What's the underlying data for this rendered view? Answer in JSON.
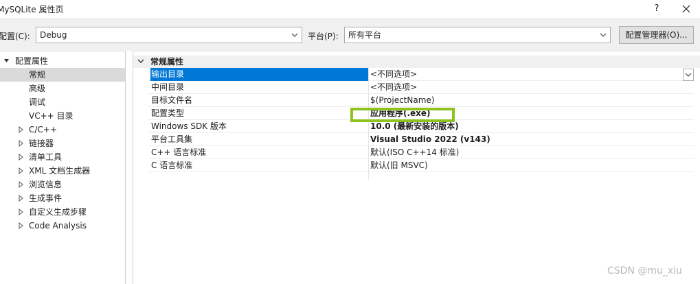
{
  "window": {
    "title": "MySQLite 属性页",
    "help_label": "?"
  },
  "toolbar": {
    "config_label": "配置(C):",
    "config_value": "Debug",
    "platform_label": "平台(P):",
    "platform_value": "所有平台",
    "manager_label": "配置管理器(O)..."
  },
  "tree": {
    "root": "配置属性",
    "items": [
      {
        "label": "常规",
        "expandable": false,
        "selected": true
      },
      {
        "label": "高级",
        "expandable": false
      },
      {
        "label": "调试",
        "expandable": false
      },
      {
        "label": "VC++ 目录",
        "expandable": false
      },
      {
        "label": "C/C++",
        "expandable": true
      },
      {
        "label": "链接器",
        "expandable": true
      },
      {
        "label": "清单工具",
        "expandable": true
      },
      {
        "label": "XML 文档生成器",
        "expandable": true
      },
      {
        "label": "浏览信息",
        "expandable": true
      },
      {
        "label": "生成事件",
        "expandable": true
      },
      {
        "label": "自定义生成步骤",
        "expandable": true
      },
      {
        "label": "Code Analysis",
        "expandable": true
      }
    ]
  },
  "grid": {
    "category": "常规属性",
    "properties": [
      {
        "name": "输出目录",
        "value": "<不同选项>",
        "bold": false,
        "selected": true
      },
      {
        "name": "中间目录",
        "value": "<不同选项>",
        "bold": false
      },
      {
        "name": "目标文件名",
        "value": "$(ProjectName)",
        "bold": false
      },
      {
        "name": "配置类型",
        "value": "应用程序(.exe)",
        "bold": true
      },
      {
        "name": "Windows SDK 版本",
        "value": "10.0 (最新安装的版本)",
        "bold": true
      },
      {
        "name": "平台工具集",
        "value": "Visual Studio 2022 (v143)",
        "bold": true
      },
      {
        "name": "C++ 语言标准",
        "value": "默认(ISO C++14 标准)",
        "bold": false
      },
      {
        "name": "C 语言标准",
        "value": "默认(旧 MSVC)",
        "bold": false
      }
    ]
  },
  "watermark": "CSDN @mu_xiu",
  "colors": {
    "selection": "#0078d7",
    "highlight": "#8dc21f",
    "tree_selected": "#dadada"
  }
}
